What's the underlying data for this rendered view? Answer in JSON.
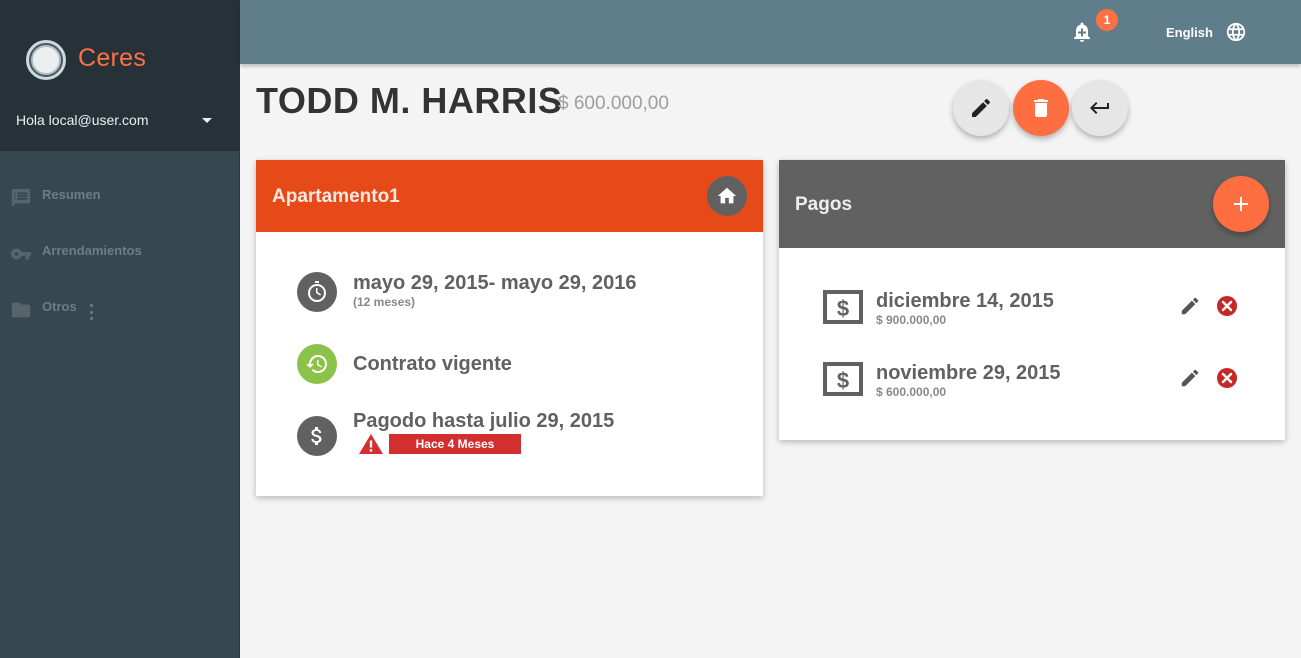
{
  "sidebar": {
    "brand": "Ceres",
    "greeting": "Hola local@user.com",
    "items": [
      {
        "label": "Resumen",
        "icon": "list-icon"
      },
      {
        "label": "Arrendamientos",
        "icon": "key-icon"
      },
      {
        "label": "Otros",
        "icon": "folder-icon"
      }
    ]
  },
  "topbar": {
    "notification_count": "1",
    "language": "English"
  },
  "tenant": {
    "name": "TODD M. HARRIS",
    "amount": "$ 600.000,00"
  },
  "property_card": {
    "title": "Apartamento1",
    "period": "mayo 29, 2015- mayo 29, 2016",
    "duration": "(12 meses)",
    "status": "Contrato vigente",
    "paid_until": "Pagodo hasta julio 29, 2015",
    "overdue_tag": "Hace 4 Meses"
  },
  "payments_card": {
    "title": "Pagos",
    "items": [
      {
        "date": "diciembre 14, 2015",
        "amount": "$ 900.000,00"
      },
      {
        "date": "noviembre 29, 2015",
        "amount": "$ 600.000,00"
      }
    ]
  },
  "colors": {
    "accent": "#ff6e40",
    "brand": "#ff7043",
    "property_header": "#e64a19",
    "payments_header": "#616161",
    "status_ok": "#8bc34a",
    "danger": "#c62828",
    "topbar": "#607d8b",
    "sidebar": "#37474f"
  }
}
